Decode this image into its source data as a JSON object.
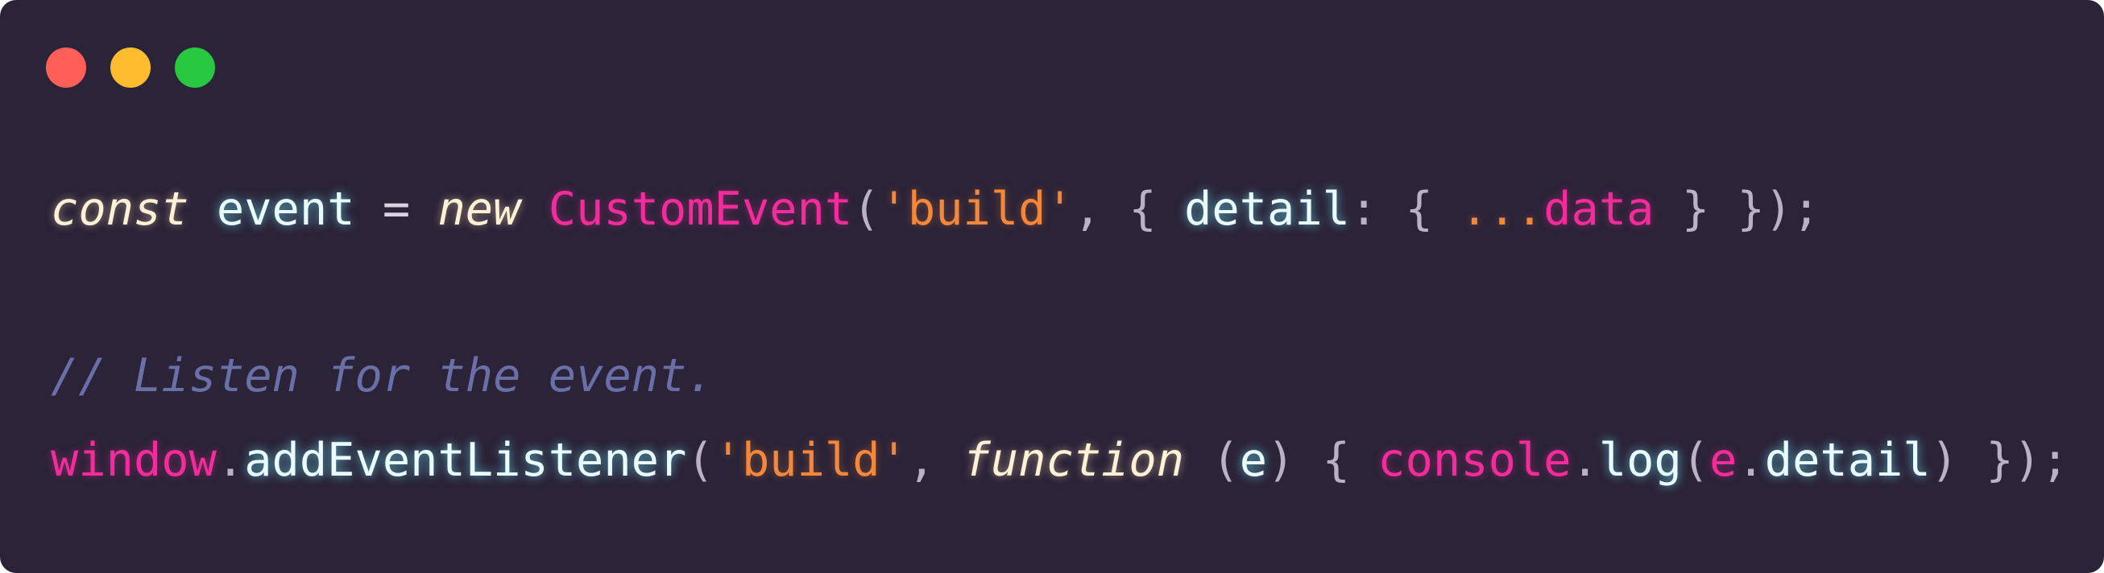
{
  "window": {
    "controls": [
      {
        "name": "close",
        "color": "#ff5f57"
      },
      {
        "name": "minimize",
        "color": "#febc2e"
      },
      {
        "name": "maximize",
        "color": "#28c840"
      }
    ]
  },
  "code": {
    "line1": {
      "t1": "const",
      "t2": " ",
      "t3": "event",
      "t4": " = ",
      "t5": "new",
      "t6": " ",
      "t7": "CustomEvent",
      "t8": "(",
      "t9": "'build'",
      "t10": ", { ",
      "t11": "detail",
      "t12": ": { ",
      "t13": "...",
      "t14": "data",
      "t15": " } });"
    },
    "line2": {
      "comment": "// Listen for the event."
    },
    "line3": {
      "t1": "window",
      "t2": ".",
      "t3": "addEventListener",
      "t4": "(",
      "t5": "'build'",
      "t6": ", ",
      "t7": "function",
      "t8": " (",
      "t9": "e",
      "t10": ") { ",
      "t11": "console",
      "t12": ".",
      "t13": "log",
      "t14": "(",
      "t15": "e",
      "t16": ".",
      "t17": "detail",
      "t18": ") });"
    }
  },
  "colors": {
    "background": "#2b2338",
    "keyword": "#fff1d6",
    "identifier": "#e9fbff",
    "pink": "#f22c9a",
    "string": "#f4883a",
    "punctuation": "#b9b2c6",
    "comment": "#6a6fa8"
  }
}
